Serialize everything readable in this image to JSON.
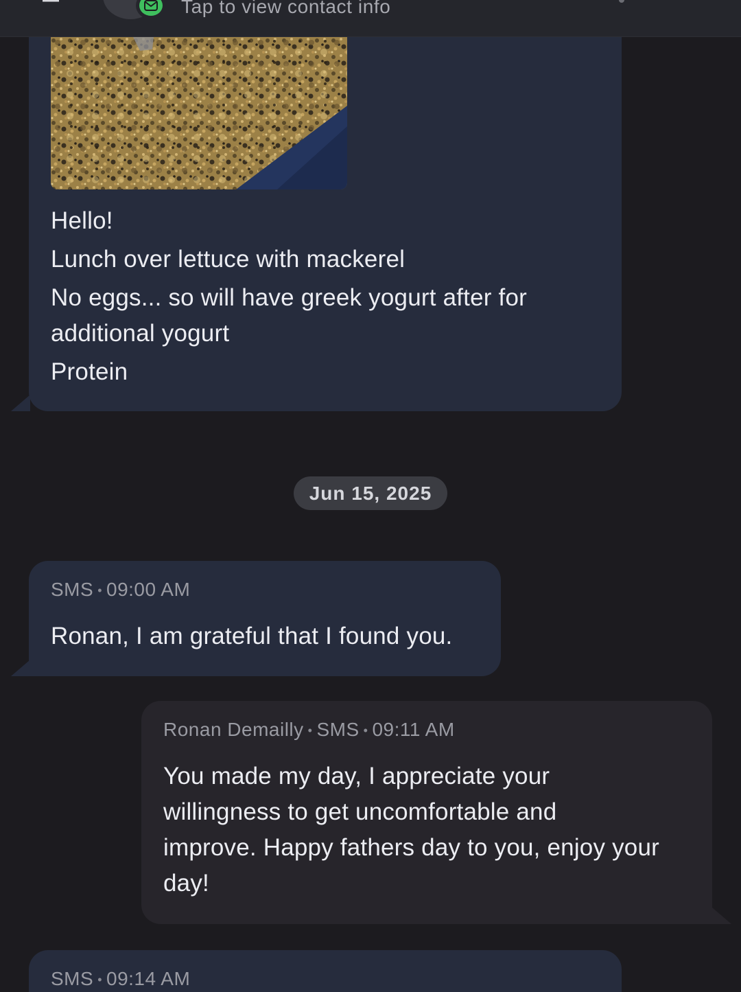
{
  "header": {
    "subtitle": "Tap to view contact info",
    "back_icon": "back-arrow-icon",
    "badge_icon": "messages-app-icon",
    "badge_color": "#3fbf5e"
  },
  "messages": [
    {
      "direction": "incoming",
      "has_image": true,
      "image_description_icon": "photo-thumbnail",
      "lines": [
        "Hello!",
        "Lunch over lettuce with mackerel",
        "No eggs... so will have greek yogurt after for",
        "additional yogurt",
        "Protein"
      ]
    }
  ],
  "date_separator": "Jun 15, 2025",
  "msg2": {
    "channel": "SMS",
    "time": "09:00 AM",
    "text": "Ronan, I am grateful that I found you."
  },
  "msg3": {
    "sender": "Ronan Demailly",
    "channel": "SMS",
    "time": "09:11 AM",
    "lines": [
      "You made my day, I appreciate your",
      "willingness to get uncomfortable and",
      "improve. Happy fathers day to you, enjoy your",
      "day!"
    ]
  },
  "msg4": {
    "channel": "SMS",
    "time": "09:14 AM"
  },
  "colors": {
    "background": "#1c1b1f",
    "incoming_bubble": "#262c3d",
    "outgoing_bubble": "#27252b",
    "header": "#25262c"
  }
}
